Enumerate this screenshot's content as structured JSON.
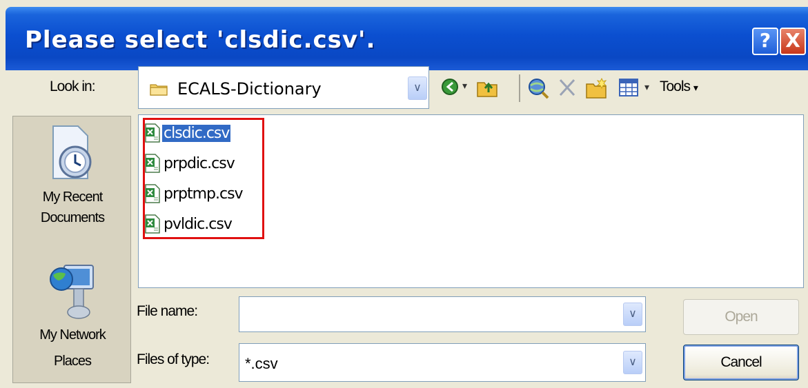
{
  "dialog": {
    "title": "Please select 'clsdic.csv'.",
    "help_button": "?",
    "close_button": "X"
  },
  "lookin": {
    "label": "Look in:",
    "value": "ECALS-Dictionary"
  },
  "toolbar": {
    "tools_label": "Tools",
    "icons": [
      "back-icon",
      "up-folder-icon",
      "search-web-icon",
      "delete-icon",
      "new-folder-icon",
      "views-icon"
    ]
  },
  "places": {
    "recent": "My Recent Documents",
    "recent_line1": "My Recent",
    "recent_line2": "Documents",
    "network_line1": "My Network",
    "network_line2": "Places"
  },
  "files": [
    {
      "name": "clsdic.csv",
      "selected": true
    },
    {
      "name": "prpdic.csv",
      "selected": false
    },
    {
      "name": "prptmp.csv",
      "selected": false
    },
    {
      "name": "pvldic.csv",
      "selected": false
    }
  ],
  "filename": {
    "label": "File name:",
    "value": ""
  },
  "filetype": {
    "label": "Files of type:",
    "value": "*.csv"
  },
  "buttons": {
    "open": "Open",
    "cancel": "Cancel"
  },
  "colors": {
    "titlebar": "#0b4fd0",
    "selection": "#316ac5",
    "highlight_box": "#e01010"
  }
}
